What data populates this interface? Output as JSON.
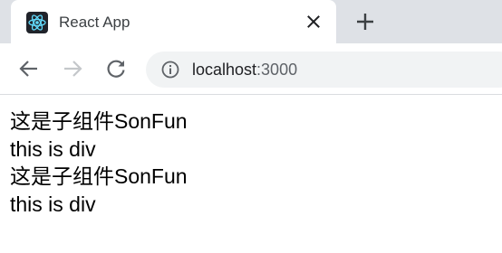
{
  "tab": {
    "title": "React App",
    "favicon_icon": "react-logo-icon",
    "close_icon": "close-icon"
  },
  "toolbar": {
    "back_icon": "back-arrow-icon",
    "forward_icon": "forward-arrow-icon",
    "reload_icon": "reload-icon",
    "new_tab_icon": "plus-icon",
    "site_info_icon": "info-icon"
  },
  "address_bar": {
    "host": "localhost",
    "port": ":3000"
  },
  "content": {
    "lines": [
      "这是子组件SonFun",
      "this is div",
      "这是子组件SonFun",
      "this is div"
    ]
  },
  "colors": {
    "tabstrip_bg": "#dee1e6",
    "omnibox_bg": "#f1f3f4",
    "react_blue": "#61dafb",
    "icon_gray": "#5f6368"
  }
}
